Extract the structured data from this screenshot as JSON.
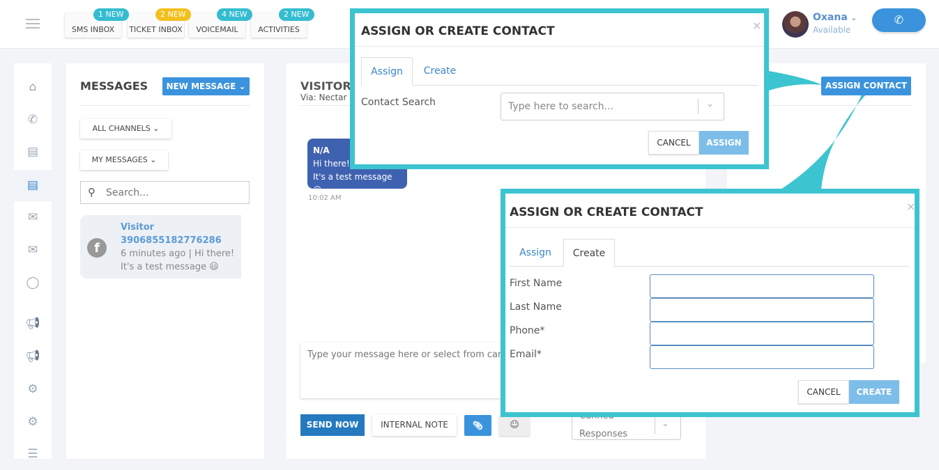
{
  "header": {
    "tabs": [
      {
        "label": "SMS INBOX",
        "badge": "1 NEW",
        "badge_color": "#35bcd0"
      },
      {
        "label": "TICKET INBOX",
        "badge": "2 NEW",
        "badge_color": "#f2c01c"
      },
      {
        "label": "VOICEMAIL",
        "badge": "4 NEW",
        "badge_color": "#35bcd0"
      },
      {
        "label": "ACTIVITIES",
        "badge": "2 NEW",
        "badge_color": "#35bcd0"
      }
    ],
    "user": {
      "name": "Oxana",
      "status": "Available"
    },
    "phone_icon": "phone-icon"
  },
  "sidebar": {
    "items": [
      "home-icon",
      "phone-icon",
      "chat-icon",
      "chat-active-icon",
      "mail-icon",
      "mail-icon",
      "speech-bubble-icon",
      "megaphone-icon",
      "megaphone-icon",
      "gear-icon",
      "gear-icon",
      "list-icon"
    ]
  },
  "messages": {
    "title": "MESSAGES",
    "new_message": "NEW MESSAGE",
    "filter_channels": "ALL CHANNELS",
    "filter_messages": "MY MESSAGES",
    "search_placeholder": "Search...",
    "items": [
      {
        "name": "Visitor 3906855182776286",
        "time": "6 minutes ago",
        "preview": "Hi there! It's a test message 😃"
      }
    ]
  },
  "conversation": {
    "title": "VISITOR 3",
    "via": "Via: Nectar D",
    "bubble": {
      "sender": "N/A",
      "line1": "Hi there!",
      "line2": "It's a test message 😃",
      "time": "10:02 AM"
    },
    "compose_placeholder": "Type your message here or select from canned responses",
    "send_now": "SEND NOW",
    "internal_note": "INTERNAL NOTE",
    "canned": "Canned Responses"
  },
  "right": {
    "assign_contact": "ASSIGN CONTACT"
  },
  "modal_assign": {
    "title": "ASSIGN OR CREATE CONTACT",
    "tab_assign": "Assign",
    "tab_create": "Create",
    "label": "Contact Search",
    "placeholder": "Type here to search...",
    "cancel": "CANCEL",
    "assign": "ASSIGN"
  },
  "modal_create": {
    "title": "ASSIGN OR CREATE CONTACT",
    "tab_assign": "Assign",
    "tab_create": "Create",
    "fields": [
      "First Name",
      "Last Name",
      "Phone*",
      "Email*"
    ],
    "cancel": "CANCEL",
    "create": "CREATE"
  },
  "colors": {
    "accent": "#3a93dc",
    "highlight": "#3cc4d0",
    "bubble": "#3f62b0"
  }
}
